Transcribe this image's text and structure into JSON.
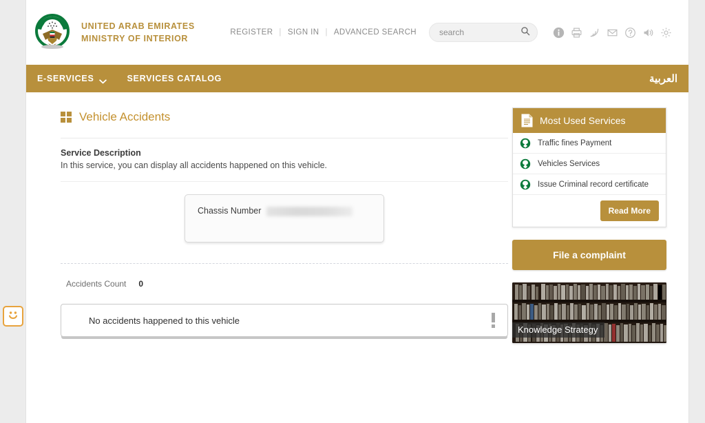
{
  "brand": {
    "line1": "UNITED ARAB EMIRATES",
    "line2": "MINISTRY OF INTERIOR",
    "crest_icon": "uae-falcon-crest-icon"
  },
  "header": {
    "links": [
      {
        "label": "REGISTER",
        "name": "register-link"
      },
      {
        "label": "SIGN IN",
        "name": "sign-in-link"
      },
      {
        "label": "ADVANCED SEARCH",
        "name": "advanced-search-link"
      }
    ],
    "separator": "|",
    "search": {
      "placeholder": "search",
      "value": "",
      "icon": "search-icon"
    },
    "icons": [
      "info-icon",
      "printer-icon",
      "rss-icon",
      "envelope-icon",
      "help-icon",
      "speaker-icon",
      "gear-icon"
    ]
  },
  "navbar": {
    "items": [
      {
        "label": "E-SERVICES",
        "name": "nav-e-services",
        "has_chevron": true
      },
      {
        "label": "SERVICES CATALOG",
        "name": "nav-services-catalog",
        "has_chevron": false
      }
    ],
    "arabic_label": "العربية"
  },
  "main": {
    "title": "Vehicle Accidents",
    "title_icon": "grid-squares-icon",
    "description_heading": "Service Description",
    "description_text": "In this service, you can display all accidents happened on this vehicle.",
    "chassis": {
      "label": "Chassis Number",
      "value": "",
      "redacted": true
    },
    "accidents": {
      "count_label": "Accidents Count",
      "count_value": "0"
    },
    "message": {
      "text": "No accidents happened to this vehicle",
      "icon": "exclamation-icon"
    }
  },
  "sidebar": {
    "most_used": {
      "title": "Most Used Services",
      "icon": "document-icon",
      "items": [
        {
          "label": "Traffic fines Payment",
          "icon": "uae-crest-mini-icon"
        },
        {
          "label": "Vehicles Services",
          "icon": "uae-crest-mini-icon"
        },
        {
          "label": "Issue Criminal record certificate",
          "icon": "uae-crest-mini-icon"
        }
      ],
      "read_more_label": "Read More"
    },
    "complaint_label": "File a complaint",
    "banner": {
      "caption": "Knowledge Strategy"
    }
  },
  "feedback": {
    "icon": "smiley-face-icon"
  },
  "colors": {
    "gold": "#b8903c",
    "title_gold": "#c4912f",
    "feedback_orange": "#e8a33d",
    "page_bg": "#ececec"
  }
}
